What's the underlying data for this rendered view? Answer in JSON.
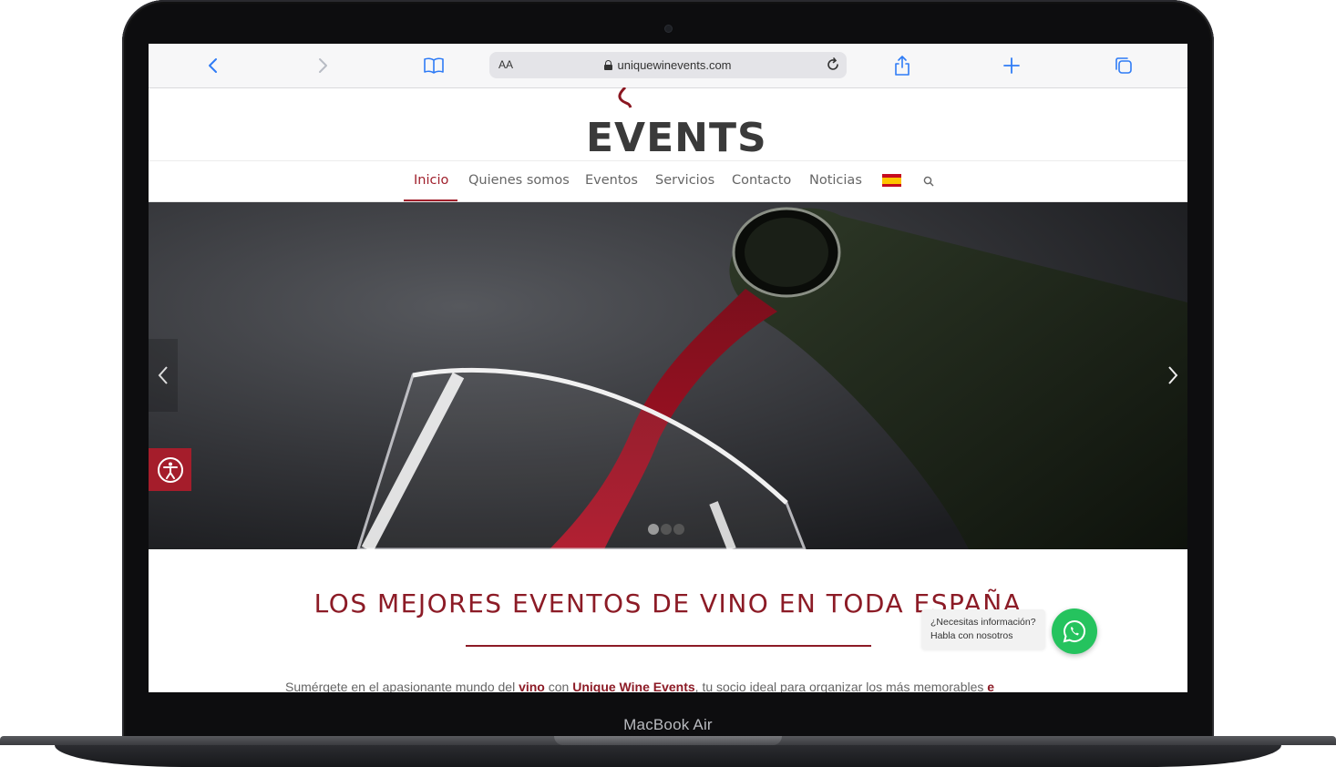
{
  "device": {
    "label": "MacBook Air"
  },
  "browser": {
    "text_size_label": "AA",
    "url": "uniquewinevents.com"
  },
  "site": {
    "logo_text": "EVENTS",
    "nav": [
      {
        "label": "Inicio",
        "active": true
      },
      {
        "label": "Quienes somos"
      },
      {
        "label": "Eventos"
      },
      {
        "label": "Servicios"
      },
      {
        "label": "Contacto"
      },
      {
        "label": "Noticias"
      }
    ],
    "language_flag": "spain-flag-icon",
    "hero": {
      "slides": 3,
      "active_slide": 1
    },
    "headline": "LOS MEJORES EVENTOS DE VINO EN TODA ESPAÑA",
    "intro": {
      "t1": "Sumérgete en el apasionante mundo del ",
      "t2": "vino",
      "t3": " con ",
      "t4": "Unique Wine Events",
      "t5": ", tu socio ideal para organizar los más memorables ",
      "t6": "e"
    },
    "whatsapp": {
      "line1": "¿Necesitas información?",
      "line2": "Habla con nosotros"
    },
    "colors": {
      "brand": "#8c1b26",
      "whatsapp": "#25c35e",
      "safari_accent": "#2f7cf6"
    }
  }
}
